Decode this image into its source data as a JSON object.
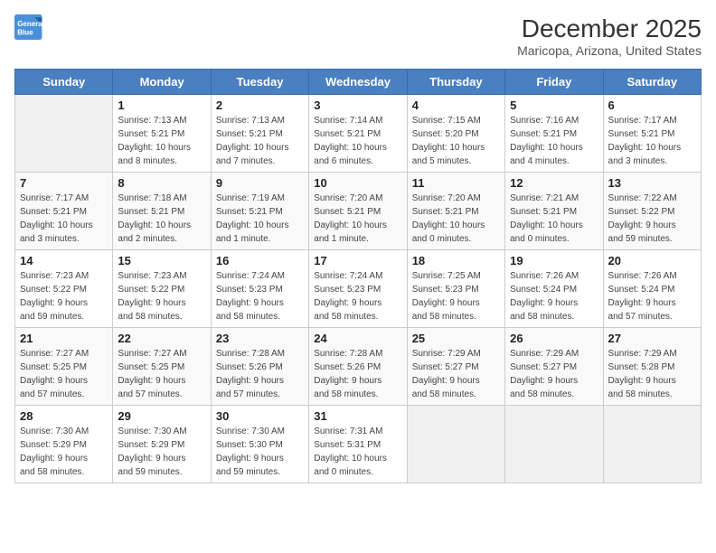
{
  "logo": {
    "line1": "General",
    "line2": "Blue"
  },
  "title": "December 2025",
  "subtitle": "Maricopa, Arizona, United States",
  "days_of_week": [
    "Sunday",
    "Monday",
    "Tuesday",
    "Wednesday",
    "Thursday",
    "Friday",
    "Saturday"
  ],
  "weeks": [
    [
      {
        "num": "",
        "info": ""
      },
      {
        "num": "1",
        "info": "Sunrise: 7:13 AM\nSunset: 5:21 PM\nDaylight: 10 hours\nand 8 minutes."
      },
      {
        "num": "2",
        "info": "Sunrise: 7:13 AM\nSunset: 5:21 PM\nDaylight: 10 hours\nand 7 minutes."
      },
      {
        "num": "3",
        "info": "Sunrise: 7:14 AM\nSunset: 5:21 PM\nDaylight: 10 hours\nand 6 minutes."
      },
      {
        "num": "4",
        "info": "Sunrise: 7:15 AM\nSunset: 5:20 PM\nDaylight: 10 hours\nand 5 minutes."
      },
      {
        "num": "5",
        "info": "Sunrise: 7:16 AM\nSunset: 5:21 PM\nDaylight: 10 hours\nand 4 minutes."
      },
      {
        "num": "6",
        "info": "Sunrise: 7:17 AM\nSunset: 5:21 PM\nDaylight: 10 hours\nand 3 minutes."
      }
    ],
    [
      {
        "num": "7",
        "info": "Sunrise: 7:17 AM\nSunset: 5:21 PM\nDaylight: 10 hours\nand 3 minutes."
      },
      {
        "num": "8",
        "info": "Sunrise: 7:18 AM\nSunset: 5:21 PM\nDaylight: 10 hours\nand 2 minutes."
      },
      {
        "num": "9",
        "info": "Sunrise: 7:19 AM\nSunset: 5:21 PM\nDaylight: 10 hours\nand 1 minute."
      },
      {
        "num": "10",
        "info": "Sunrise: 7:20 AM\nSunset: 5:21 PM\nDaylight: 10 hours\nand 1 minute."
      },
      {
        "num": "11",
        "info": "Sunrise: 7:20 AM\nSunset: 5:21 PM\nDaylight: 10 hours\nand 0 minutes."
      },
      {
        "num": "12",
        "info": "Sunrise: 7:21 AM\nSunset: 5:21 PM\nDaylight: 10 hours\nand 0 minutes."
      },
      {
        "num": "13",
        "info": "Sunrise: 7:22 AM\nSunset: 5:22 PM\nDaylight: 9 hours\nand 59 minutes."
      }
    ],
    [
      {
        "num": "14",
        "info": "Sunrise: 7:23 AM\nSunset: 5:22 PM\nDaylight: 9 hours\nand 59 minutes."
      },
      {
        "num": "15",
        "info": "Sunrise: 7:23 AM\nSunset: 5:22 PM\nDaylight: 9 hours\nand 58 minutes."
      },
      {
        "num": "16",
        "info": "Sunrise: 7:24 AM\nSunset: 5:23 PM\nDaylight: 9 hours\nand 58 minutes."
      },
      {
        "num": "17",
        "info": "Sunrise: 7:24 AM\nSunset: 5:23 PM\nDaylight: 9 hours\nand 58 minutes."
      },
      {
        "num": "18",
        "info": "Sunrise: 7:25 AM\nSunset: 5:23 PM\nDaylight: 9 hours\nand 58 minutes."
      },
      {
        "num": "19",
        "info": "Sunrise: 7:26 AM\nSunset: 5:24 PM\nDaylight: 9 hours\nand 58 minutes."
      },
      {
        "num": "20",
        "info": "Sunrise: 7:26 AM\nSunset: 5:24 PM\nDaylight: 9 hours\nand 57 minutes."
      }
    ],
    [
      {
        "num": "21",
        "info": "Sunrise: 7:27 AM\nSunset: 5:25 PM\nDaylight: 9 hours\nand 57 minutes."
      },
      {
        "num": "22",
        "info": "Sunrise: 7:27 AM\nSunset: 5:25 PM\nDaylight: 9 hours\nand 57 minutes."
      },
      {
        "num": "23",
        "info": "Sunrise: 7:28 AM\nSunset: 5:26 PM\nDaylight: 9 hours\nand 57 minutes."
      },
      {
        "num": "24",
        "info": "Sunrise: 7:28 AM\nSunset: 5:26 PM\nDaylight: 9 hours\nand 58 minutes."
      },
      {
        "num": "25",
        "info": "Sunrise: 7:29 AM\nSunset: 5:27 PM\nDaylight: 9 hours\nand 58 minutes."
      },
      {
        "num": "26",
        "info": "Sunrise: 7:29 AM\nSunset: 5:27 PM\nDaylight: 9 hours\nand 58 minutes."
      },
      {
        "num": "27",
        "info": "Sunrise: 7:29 AM\nSunset: 5:28 PM\nDaylight: 9 hours\nand 58 minutes."
      }
    ],
    [
      {
        "num": "28",
        "info": "Sunrise: 7:30 AM\nSunset: 5:29 PM\nDaylight: 9 hours\nand 58 minutes."
      },
      {
        "num": "29",
        "info": "Sunrise: 7:30 AM\nSunset: 5:29 PM\nDaylight: 9 hours\nand 59 minutes."
      },
      {
        "num": "30",
        "info": "Sunrise: 7:30 AM\nSunset: 5:30 PM\nDaylight: 9 hours\nand 59 minutes."
      },
      {
        "num": "31",
        "info": "Sunrise: 7:31 AM\nSunset: 5:31 PM\nDaylight: 10 hours\nand 0 minutes."
      },
      {
        "num": "",
        "info": ""
      },
      {
        "num": "",
        "info": ""
      },
      {
        "num": "",
        "info": ""
      }
    ]
  ]
}
